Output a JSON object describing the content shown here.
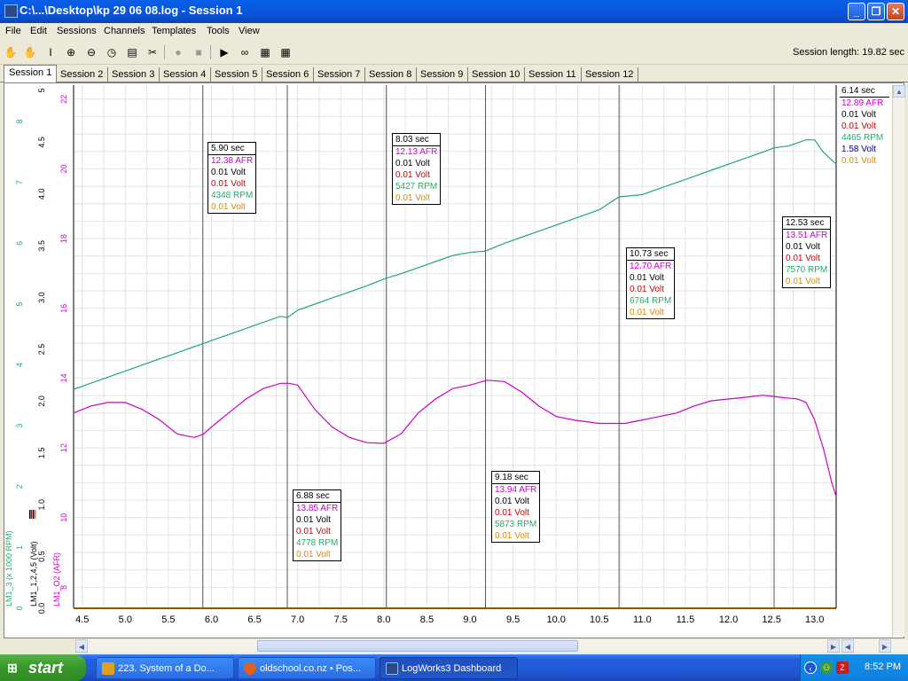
{
  "window": {
    "title": "C:\\...\\Desktop\\kp 29 06 08.log - Session 1"
  },
  "menu": [
    "File",
    "Edit",
    "Sessions",
    "Channels",
    "Templates",
    "Tools",
    "View"
  ],
  "toolbar": {
    "session_length": "Session length:  19.82 sec",
    "icons": [
      "hand-icon",
      "hand-disabled-icon",
      "text-cursor-icon",
      "zoom-in-icon",
      "zoom-out-icon",
      "stopwatch-icon",
      "notepad-icon",
      "tools-icon",
      "record-icon",
      "stop-icon",
      "play-icon",
      "binoculars-icon",
      "chart-grid-icon",
      "table-icon"
    ]
  },
  "tabs": [
    "Session 1",
    "Session 2",
    "Session 3",
    "Session 4",
    "Session 5",
    "Session 6",
    "Session 7",
    "Session 8",
    "Session 9",
    "Session 10",
    "Session 11",
    "Session 12"
  ],
  "colors": {
    "afr": "#cc00cc",
    "volt1": "#000000",
    "volt2": "#cc0000",
    "rpm": "#22aa66",
    "volt3": "#dd8800",
    "volt4": "#000088"
  },
  "chart_data": {
    "type": "line",
    "xlim": [
      4.4,
      13.25
    ],
    "x_ticks": [
      "4.5",
      "5.0",
      "5.5",
      "6.0",
      "6.5",
      "7.0",
      "7.5",
      "8.0",
      "8.5",
      "9.0",
      "9.5",
      "10.0",
      "10.5",
      "11.0",
      "11.5",
      "12.0",
      "12.5",
      "13.0"
    ],
    "y_axes": [
      {
        "label": "LM1_3 (x 1000 RPM)",
        "ticks": [
          "0",
          "1",
          "2",
          "3",
          "4",
          "5",
          "6",
          "7",
          "8"
        ]
      },
      {
        "label": "LM1_1,2,4,5 (Volt)",
        "ticks": [
          "0.0",
          "0.5",
          "1.0",
          "1.5",
          "2.0",
          "2.5",
          "3.0",
          "3.5",
          "4.0",
          "4.5",
          "5"
        ]
      },
      {
        "label": "LM1_O2 (AFR)",
        "ticks": [
          "8",
          "10",
          "12",
          "14",
          "16",
          "18",
          "20",
          "22"
        ]
      }
    ],
    "afr_range": [
      7.4,
      22.4
    ],
    "rpm_range": [
      0,
      8.6
    ],
    "series": [
      {
        "name": "LM1_O2 (AFR)",
        "x": [
          4.4,
          4.6,
          4.8,
          5.0,
          5.2,
          5.4,
          5.6,
          5.8,
          5.9,
          6.0,
          6.2,
          6.4,
          6.6,
          6.8,
          6.9,
          7.0,
          7.2,
          7.4,
          7.6,
          7.8,
          8.0,
          8.2,
          8.4,
          8.6,
          8.8,
          9.0,
          9.2,
          9.4,
          9.6,
          9.8,
          10.0,
          10.2,
          10.5,
          10.8,
          11.0,
          11.2,
          11.4,
          11.6,
          11.8,
          12.0,
          12.2,
          12.4,
          12.6,
          12.8,
          12.9,
          13.0,
          13.1,
          13.2,
          13.25
        ],
        "y": [
          13.0,
          13.2,
          13.3,
          13.3,
          13.1,
          12.8,
          12.4,
          12.3,
          12.38,
          12.6,
          13.0,
          13.4,
          13.7,
          13.85,
          13.85,
          13.8,
          13.1,
          12.6,
          12.3,
          12.15,
          12.13,
          12.4,
          13.0,
          13.4,
          13.7,
          13.8,
          13.94,
          13.9,
          13.6,
          13.2,
          12.9,
          12.8,
          12.7,
          12.7,
          12.8,
          12.9,
          13.0,
          13.2,
          13.35,
          13.4,
          13.45,
          13.51,
          13.45,
          13.4,
          13.3,
          12.8,
          12.0,
          11.0,
          10.6
        ]
      },
      {
        "name": "LM1_3 (x 1000 RPM)",
        "x": [
          4.4,
          4.6,
          4.8,
          5.0,
          5.2,
          5.4,
          5.6,
          5.8,
          5.9,
          6.0,
          6.2,
          6.4,
          6.6,
          6.8,
          6.88,
          7.0,
          7.2,
          7.4,
          7.6,
          7.8,
          8.03,
          8.2,
          8.4,
          8.6,
          8.8,
          9.0,
          9.18,
          9.4,
          9.6,
          9.8,
          10.0,
          10.2,
          10.5,
          10.73,
          11.0,
          11.2,
          11.4,
          11.6,
          11.8,
          12.0,
          12.2,
          12.4,
          12.53,
          12.7,
          12.9,
          13.0,
          13.1,
          13.25
        ],
        "y": [
          3.6,
          3.7,
          3.8,
          3.9,
          4.0,
          4.1,
          4.2,
          4.3,
          4.348,
          4.4,
          4.5,
          4.6,
          4.7,
          4.8,
          4.778,
          4.9,
          5.0,
          5.1,
          5.2,
          5.3,
          5.427,
          5.5,
          5.6,
          5.7,
          5.8,
          5.85,
          5.873,
          6.0,
          6.1,
          6.2,
          6.3,
          6.4,
          6.55,
          6.764,
          6.8,
          6.9,
          7.0,
          7.1,
          7.2,
          7.3,
          7.4,
          7.5,
          7.57,
          7.6,
          7.7,
          7.7,
          7.5,
          7.3
        ]
      }
    ],
    "markers": [
      {
        "time": "5.90 sec",
        "x": 5.9,
        "rows": [
          "12.38 AFR",
          "0.01 Volt",
          "0.01 Volt",
          "4348 RPM",
          "0.01 Volt"
        ]
      },
      {
        "time": "6.88 sec",
        "x": 6.88,
        "rows": [
          "13.85 AFR",
          "0.01 Volt",
          "0.01 Volt",
          "4778 RPM",
          "0.01 Volt"
        ]
      },
      {
        "time": "8.03 sec",
        "x": 8.03,
        "rows": [
          "12.13 AFR",
          "0.01 Volt",
          "0.01 Volt",
          "5427 RPM",
          "0.01 Volt"
        ]
      },
      {
        "time": "9.18 sec",
        "x": 9.18,
        "rows": [
          "13.94 AFR",
          "0.01 Volt",
          "0.01 Volt",
          "5873 RPM",
          "0.01 Volt"
        ]
      },
      {
        "time": "10.73 sec",
        "x": 10.73,
        "rows": [
          "12.70 AFR",
          "0.01 Volt",
          "0.01 Volt",
          "6764 RPM",
          "0.01 Volt"
        ]
      },
      {
        "time": "12.53 sec",
        "x": 12.53,
        "rows": [
          "13.51 AFR",
          "0.01 Volt",
          "0.01 Volt",
          "7570 RPM",
          "0.01 Volt"
        ]
      }
    ],
    "legend": {
      "time": "6.14 sec",
      "rows": [
        "12.89 AFR",
        "0.01 Volt",
        "0.01 Volt",
        "4465 RPM",
        "1.58 Volt",
        "0.01 Volt"
      ]
    },
    "grid": true
  },
  "taskbar": {
    "start": "start",
    "tasks": [
      {
        "label": "223. System of a Do...",
        "icon": "media-player-icon"
      },
      {
        "label": "oldschool.co.nz • Pos...",
        "icon": "firefox-icon"
      },
      {
        "label": "LogWorks3 Dashboard",
        "icon": "logworks-icon"
      }
    ],
    "clock": "8:52 PM"
  }
}
